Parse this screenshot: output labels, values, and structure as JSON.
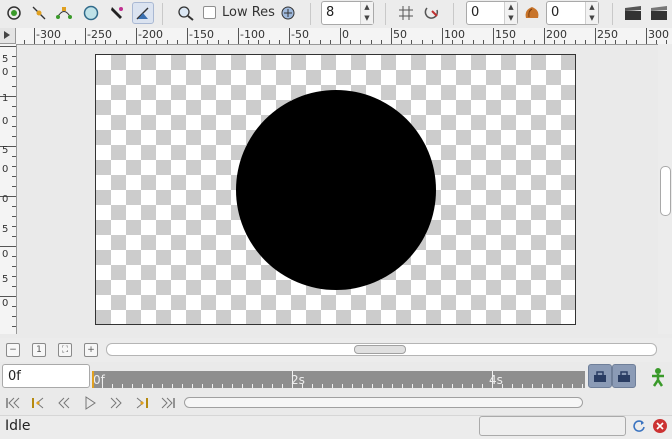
{
  "toolbar": {
    "tools": [
      {
        "name": "transform-tool-icon",
        "active": false
      },
      {
        "name": "smooth-move-tool-icon",
        "active": false
      },
      {
        "name": "scale-tool-icon",
        "active": false
      },
      {
        "name": "circle-tool-icon",
        "active": false
      },
      {
        "name": "draw-tool-icon",
        "active": false
      },
      {
        "name": "fill-tool-icon",
        "active": true
      }
    ],
    "low_res_label": "Low Res",
    "low_res_checked": false,
    "quality_value": "8",
    "onion_past_value": "0",
    "onion_future_value": "0"
  },
  "hruler": {
    "labels": [
      "-300",
      "-250",
      "-200",
      "-150",
      "-100",
      "-50",
      "0",
      "50",
      "100",
      "150",
      "200",
      "250",
      "300"
    ]
  },
  "vruler": {
    "labels": [
      "5",
      "0",
      "1",
      "0",
      "5",
      "0",
      "0",
      "5",
      "0",
      "5",
      "0"
    ]
  },
  "canvas": {
    "shape": "circle",
    "fill_color": "#000000"
  },
  "timebar": {
    "current_time": "0f",
    "labels": [
      "0f",
      "2s",
      "4s"
    ]
  },
  "status": {
    "text": "Idle"
  },
  "colors": {
    "accent": "#8b9bb6",
    "stop": "#cc3333"
  }
}
